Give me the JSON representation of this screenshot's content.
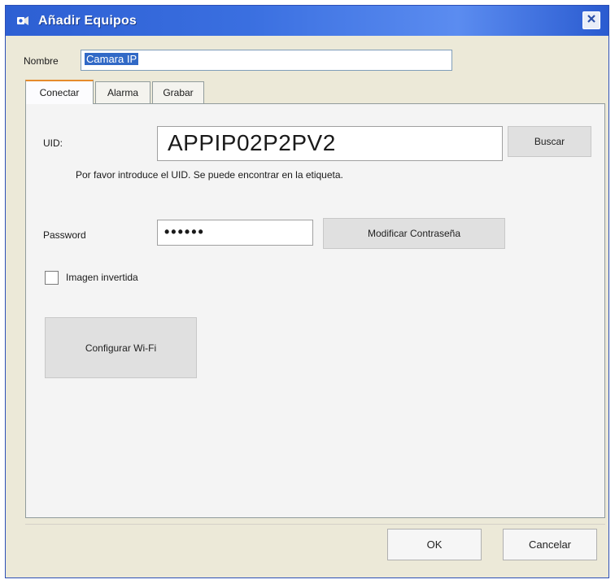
{
  "window": {
    "title": "Añadir Equipos",
    "close_icon": "close-icon"
  },
  "name_field": {
    "label": "Nombre",
    "value": "Camara IP"
  },
  "tabs": [
    {
      "label": "Conectar",
      "active": true
    },
    {
      "label": "Alarma",
      "active": false
    },
    {
      "label": "Grabar",
      "active": false
    }
  ],
  "connect": {
    "uid_label": "UID:",
    "uid_value": "APPIP02P2PV2",
    "search_button": "Buscar",
    "uid_hint": "Por favor introduce el UID. Se puede encontrar en la etiqueta.",
    "password_label": "Password",
    "password_value": "••••••",
    "change_password_button": "Modificar Contraseña",
    "invert_image_label": "Imagen invertida",
    "invert_image_checked": false,
    "wifi_button": "Configurar Wi-Fi"
  },
  "footer": {
    "ok_button": "OK",
    "cancel_button": "Cancelar"
  },
  "colors": {
    "titlebar": "#2d5fd3",
    "active_tab_accent": "#e68b2c",
    "selection": "#3169c6"
  }
}
